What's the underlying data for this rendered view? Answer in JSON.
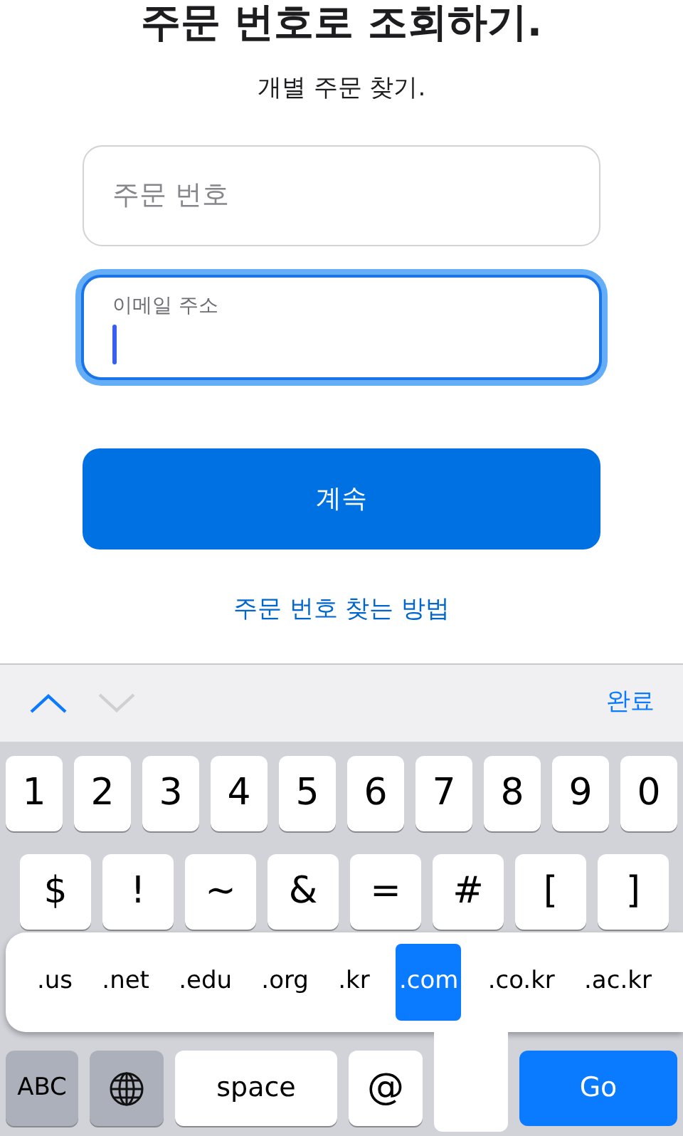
{
  "title": "주문 번호로 조회하기.",
  "subtitle": "개별 주문 찾기.",
  "fields": [
    {
      "placeholder": "주문 번호",
      "focused": false
    },
    {
      "placeholder": "이메일 주소",
      "focused": true
    }
  ],
  "continue_button": "계속",
  "help_link": "주문 번호 찾는 방법",
  "toolbar": {
    "previous_enabled": true,
    "next_enabled": false,
    "done": "완료"
  },
  "keyboard": {
    "number_row": [
      "1",
      "2",
      "3",
      "4",
      "5",
      "6",
      "7",
      "8",
      "9",
      "0"
    ],
    "symbol_row": [
      "$",
      "!",
      "~",
      "&",
      "=",
      "#",
      "[",
      "]"
    ],
    "domain_popup": [
      {
        "label": ".us",
        "selected": false
      },
      {
        "label": ".net",
        "selected": false
      },
      {
        "label": ".edu",
        "selected": false
      },
      {
        "label": ".org",
        "selected": false
      },
      {
        "label": ".kr",
        "selected": false
      },
      {
        "label": ".com",
        "selected": true
      },
      {
        "label": ".co.kr",
        "selected": false
      },
      {
        "label": ".ac.kr",
        "selected": false
      }
    ],
    "bottom_row": [
      {
        "kind": "mode",
        "label": "ABC"
      },
      {
        "kind": "globe"
      },
      {
        "kind": "space",
        "label": "space"
      },
      {
        "kind": "key",
        "label": "@"
      },
      {
        "kind": "action",
        "label": "Go"
      }
    ]
  }
}
